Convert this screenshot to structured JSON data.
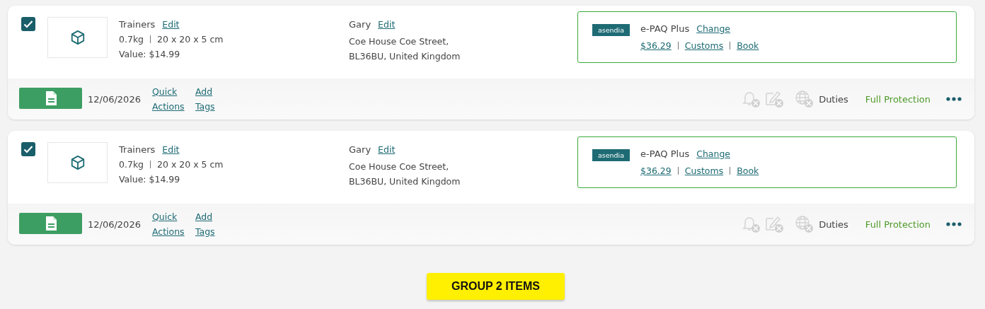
{
  "shipments": [
    {
      "checked": true,
      "product": "Trainers",
      "product_edit": "Edit",
      "weight": "0.7kg",
      "dimensions": "20 x 20 x 5 cm",
      "value": "Value: $14.99",
      "recipient": "Gary",
      "recipient_edit": "Edit",
      "address": [
        "Coe House Coe Street,",
        "BL36BU, United Kingdom"
      ],
      "carrier_logo": "asendia",
      "service": "e-PAQ Plus",
      "change": "Change",
      "price": "$36.29",
      "customs": "Customs",
      "book": "Book",
      "date": "12/06/2026",
      "quick_actions": "Quick Actions",
      "add_tags": "Add Tags",
      "duties": "Duties",
      "protection": "Full Protection"
    },
    {
      "checked": true,
      "product": "Trainers",
      "product_edit": "Edit",
      "weight": "0.7kg",
      "dimensions": "20 x 20 x 5 cm",
      "value": "Value: $14.99",
      "recipient": "Gary",
      "recipient_edit": "Edit",
      "address": [
        "Coe House Coe Street,",
        "BL36BU, United Kingdom"
      ],
      "carrier_logo": "asendia",
      "service": "e-PAQ Plus",
      "change": "Change",
      "price": "$36.29",
      "customs": "Customs",
      "book": "Book",
      "date": "12/06/2026",
      "quick_actions": "Quick Actions",
      "add_tags": "Add Tags",
      "duties": "Duties",
      "protection": "Full Protection"
    }
  ],
  "group_button": "GROUP 2 ITEMS"
}
